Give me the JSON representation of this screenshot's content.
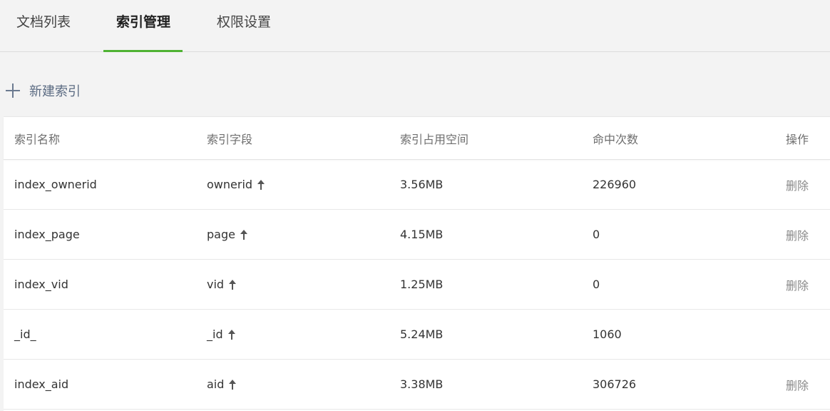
{
  "tabs": [
    {
      "label": "文档列表",
      "active": false
    },
    {
      "label": "索引管理",
      "active": true
    },
    {
      "label": "权限设置",
      "active": false
    }
  ],
  "toolbar": {
    "new_index_label": "新建索引"
  },
  "table": {
    "headers": [
      "索引名称",
      "索引字段",
      "索引占用空间",
      "命中次数",
      "操作"
    ],
    "rows": [
      {
        "name": "index_ownerid",
        "field": "ownerid",
        "size": "3.56MB",
        "hits": "226960",
        "action": "删除"
      },
      {
        "name": "index_page",
        "field": "page",
        "size": "4.15MB",
        "hits": "0",
        "action": "删除"
      },
      {
        "name": "index_vid",
        "field": "vid",
        "size": "1.25MB",
        "hits": "0",
        "action": "删除"
      },
      {
        "name": "_id_",
        "field": "_id",
        "size": "5.24MB",
        "hits": "1060",
        "action": ""
      },
      {
        "name": "index_aid",
        "field": "aid",
        "size": "3.38MB",
        "hits": "306726",
        "action": "删除"
      }
    ]
  },
  "icons": {
    "add": "plus-icon",
    "sort": "arrow-up-icon"
  },
  "colors": {
    "tab_active_underline": "#4fb233",
    "background": "#f3f3f3",
    "link": "#5b6b82"
  }
}
